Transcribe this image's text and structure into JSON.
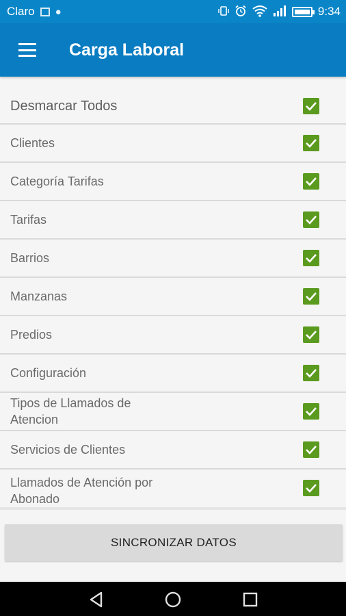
{
  "status_bar": {
    "carrier": "Claro",
    "time": "9:34"
  },
  "app_bar": {
    "title": "Carga Laboral"
  },
  "list": {
    "header": {
      "label": "Desmarcar Todos",
      "checked": true
    },
    "items": [
      {
        "label": "Clientes",
        "checked": true
      },
      {
        "label": "Categoría Tarifas",
        "checked": true
      },
      {
        "label": "Tarifas",
        "checked": true
      },
      {
        "label": "Barrios",
        "checked": true
      },
      {
        "label": "Manzanas",
        "checked": true
      },
      {
        "label": "Predios",
        "checked": true
      },
      {
        "label": "Configuración",
        "checked": true
      },
      {
        "label": "Tipos de Llamados de Atencion",
        "checked": true
      },
      {
        "label": "Servicios de Clientes",
        "checked": true
      },
      {
        "label": "Llamados de Atención por Abonado",
        "checked": true
      }
    ]
  },
  "actions": {
    "sync_label": "SINCRONIZAR DATOS"
  },
  "colors": {
    "status_bar": "#0a86c8",
    "app_bar": "#0a7cc1",
    "checkbox": "#5a9a1e"
  },
  "icons": [
    "menu-icon",
    "back-icon",
    "home-icon",
    "recents-icon",
    "wifi-icon",
    "alarm-icon",
    "vibrate-icon",
    "signal-icon",
    "battery-icon"
  ]
}
